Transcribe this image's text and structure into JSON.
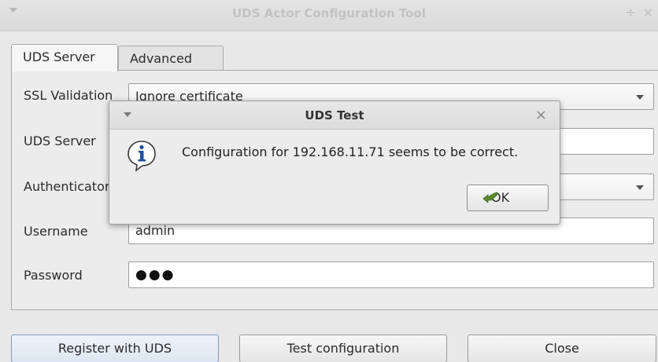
{
  "window": {
    "title": "UDS Actor Configuration Tool",
    "controls": [
      "÷",
      "×"
    ]
  },
  "tabs": [
    {
      "label": "UDS Server",
      "active": true
    },
    {
      "label": "Advanced",
      "active": false
    }
  ],
  "form": {
    "ssl_label": "SSL Validation",
    "ssl_value": "Ignore certificate",
    "server_label": "UDS Server",
    "server_value": "",
    "auth_label": "Authenticator",
    "auth_value": "",
    "username_label": "Username",
    "username_value": "admin",
    "password_label": "Password",
    "password_value": "●●●"
  },
  "buttons": {
    "register": "Register with UDS",
    "test": "Test configuration",
    "close": "Close"
  },
  "dialog": {
    "title": "UDS Test",
    "close_glyph": "×",
    "message": "Configuration for 192.168.11.71 seems to be correct.",
    "ok_label": "OK",
    "icon": "info-icon"
  },
  "colors": {
    "info_blue": "#1f4f9c",
    "ok_icon_green": "#5a8a2e"
  }
}
